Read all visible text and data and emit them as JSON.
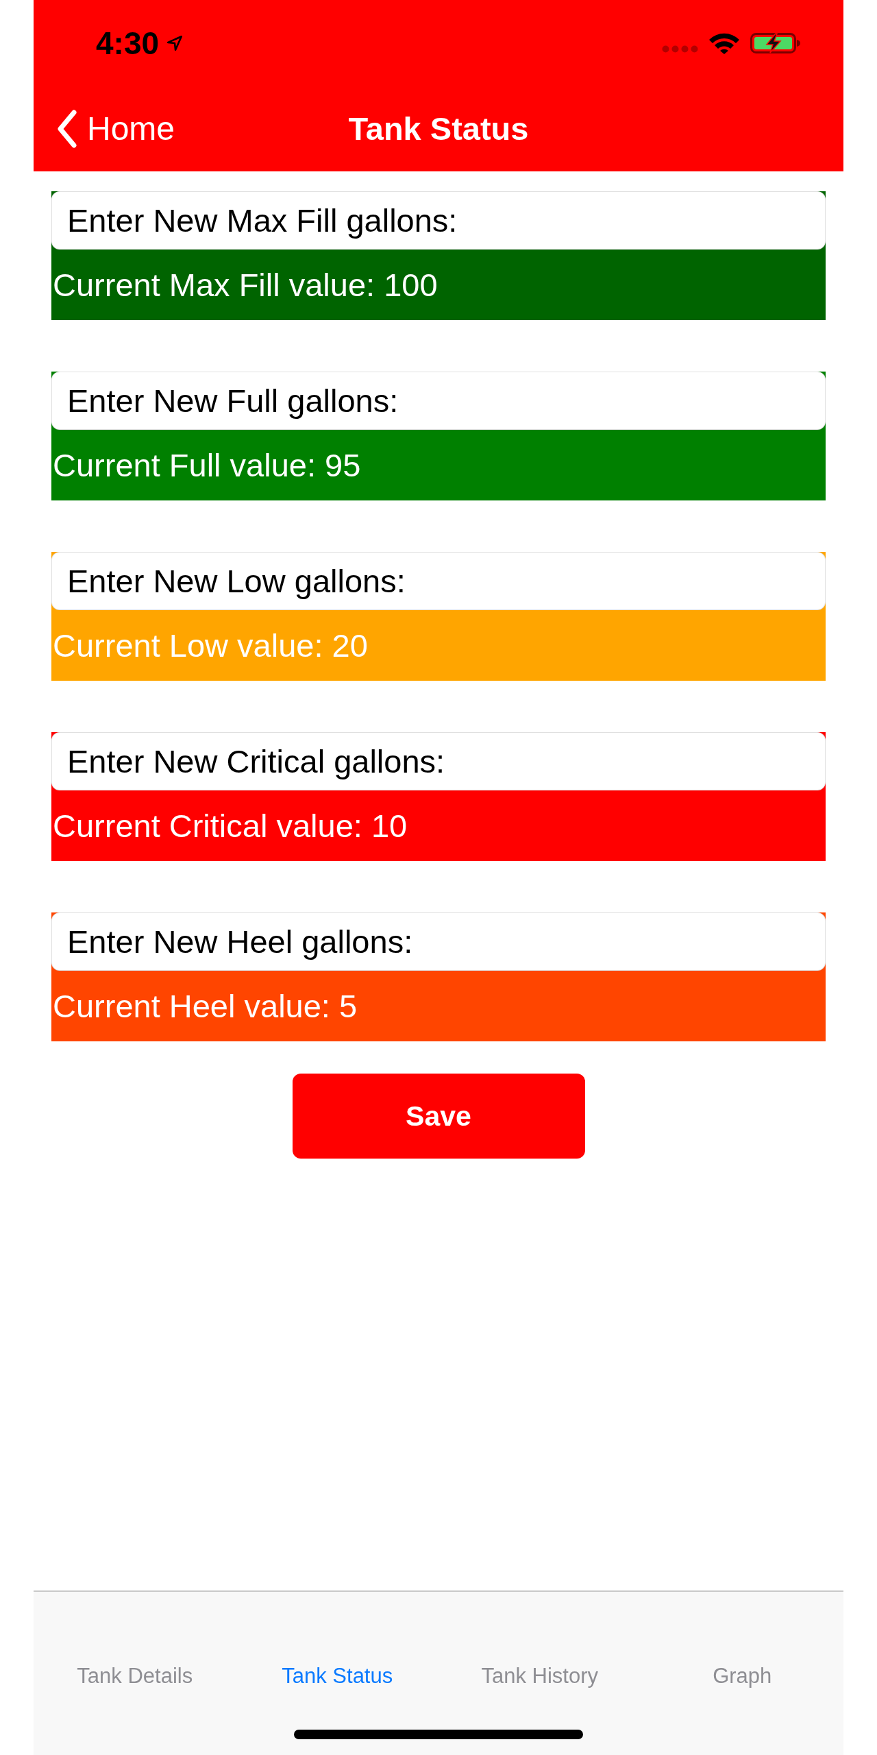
{
  "status_bar": {
    "time": "4:30"
  },
  "nav_bar": {
    "back_label": "Home",
    "title": "Tank Status"
  },
  "thresholds": [
    {
      "placeholder": "Enter New Max Fill gallons:",
      "current": "Current Max Fill value: 100",
      "color": "#006400"
    },
    {
      "placeholder": "Enter New Full gallons:",
      "current": "Current Full value: 95",
      "color": "#008000"
    },
    {
      "placeholder": "Enter New Low gallons:",
      "current": "Current Low value: 20",
      "color": "#ffa500"
    },
    {
      "placeholder": "Enter New Critical gallons:",
      "current": "Current Critical value: 10",
      "color": "#ff0000"
    },
    {
      "placeholder": "Enter New Heel gallons:",
      "current": "Current Heel value: 5",
      "color": "#ff4500"
    }
  ],
  "save_button": {
    "label": "Save"
  },
  "tab_bar": {
    "tabs": [
      {
        "label": "Tank Details",
        "selected": false
      },
      {
        "label": "Tank Status",
        "selected": true
      },
      {
        "label": "Tank History",
        "selected": false
      },
      {
        "label": "Graph",
        "selected": false
      }
    ]
  }
}
